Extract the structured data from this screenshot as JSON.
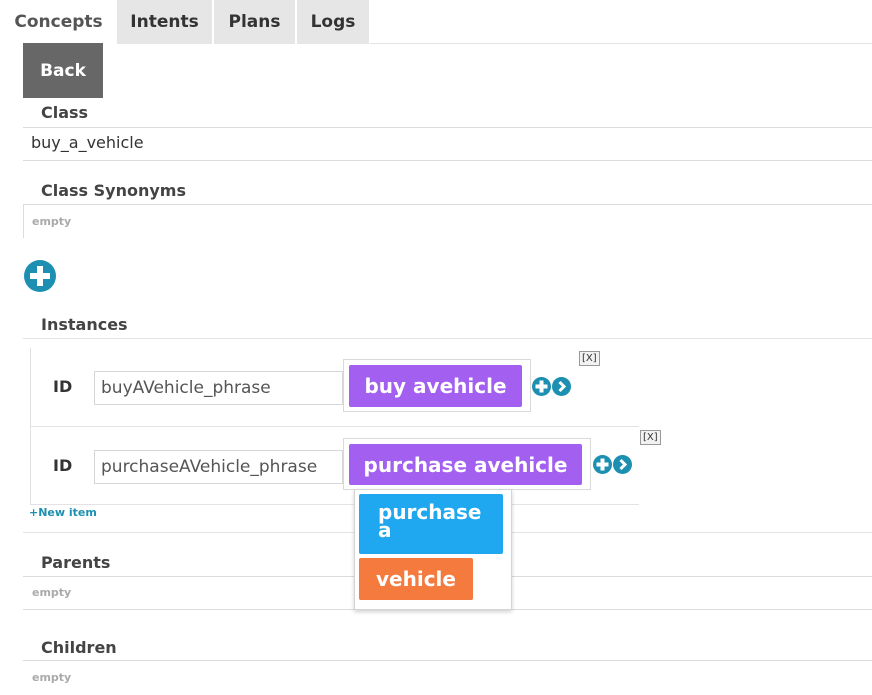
{
  "tabs": [
    {
      "label": "Concepts",
      "active": true
    },
    {
      "label": "Intents",
      "active": false
    },
    {
      "label": "Plans",
      "active": false
    },
    {
      "label": "Logs",
      "active": false
    }
  ],
  "back_label": "Back",
  "class_section": {
    "label": "Class",
    "value": "buy_a_vehicle"
  },
  "synonyms_section": {
    "label": "Class Synonyms",
    "value": "empty"
  },
  "instances_section": {
    "label": "Instances",
    "rows": [
      {
        "id_label": "ID",
        "id_value": "buyAVehicle_phrase",
        "phrase": "buy avehicle",
        "remove_label": "[X]"
      },
      {
        "id_label": "ID",
        "id_value": "purchaseAVehicle_phrase",
        "phrase": "purchase avehicle",
        "remove_label": "[X]"
      }
    ],
    "new_item_label": "+New item"
  },
  "phrase_dropdown": {
    "tokens": [
      {
        "line1": "purchase",
        "line2": "a",
        "color": "#1fa8ef"
      },
      {
        "label": "vehicle",
        "color": "#f47a3e"
      }
    ]
  },
  "parents_section": {
    "label": "Parents",
    "value": "empty"
  },
  "children_section": {
    "label": "Children",
    "value": "empty"
  },
  "colors": {
    "phrase_chip": "#a25ff0",
    "accent": "#1d8fb0",
    "back_button": "#676767"
  }
}
